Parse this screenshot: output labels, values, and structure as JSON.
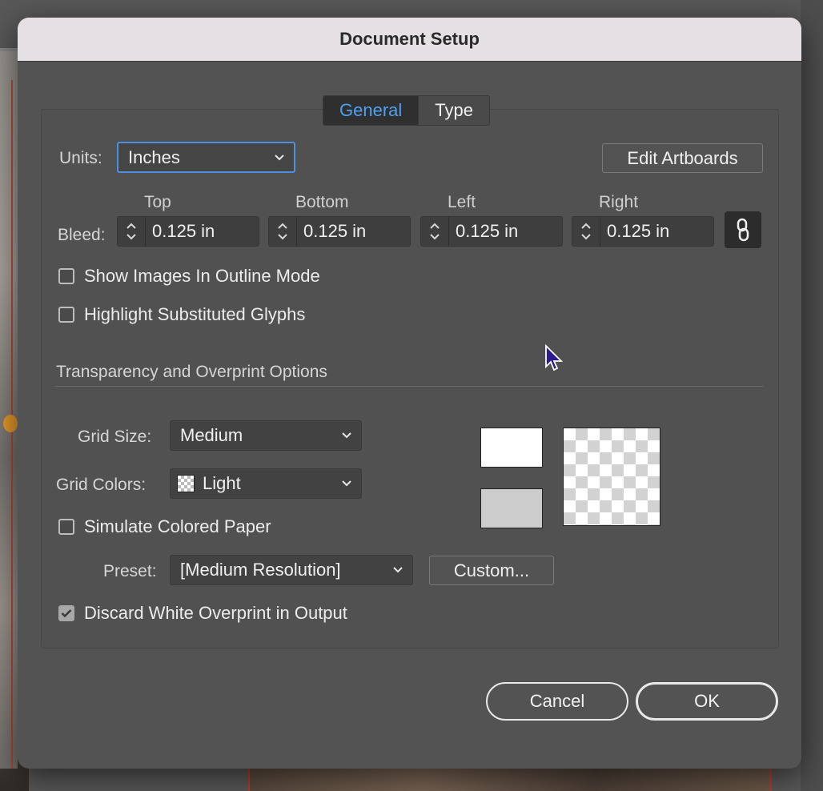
{
  "dialog": {
    "title": "Document Setup"
  },
  "tabs": [
    {
      "label": "General",
      "active": true
    },
    {
      "label": "Type",
      "active": false
    }
  ],
  "units": {
    "label": "Units:",
    "value": "Inches"
  },
  "edit_artboards_label": "Edit Artboards",
  "bleed": {
    "label": "Bleed:",
    "fields": [
      {
        "heading": "Top",
        "value": "0.125 in"
      },
      {
        "heading": "Bottom",
        "value": "0.125 in"
      },
      {
        "heading": "Left",
        "value": "0.125 in"
      },
      {
        "heading": "Right",
        "value": "0.125 in"
      }
    ],
    "link_icon": "chain-link-icon"
  },
  "options": {
    "show_images_outline": {
      "label": "Show Images In Outline Mode",
      "checked": false
    },
    "highlight_glyphs": {
      "label": "Highlight Substituted Glyphs",
      "checked": false
    }
  },
  "transparency": {
    "section_title": "Transparency and Overprint Options",
    "grid_size": {
      "label": "Grid Size:",
      "value": "Medium"
    },
    "grid_colors": {
      "label": "Grid Colors:",
      "value": "Light"
    },
    "simulate_paper": {
      "label": "Simulate Colored Paper",
      "checked": false
    },
    "preset": {
      "label": "Preset:",
      "value": "[Medium Resolution]"
    },
    "custom_label": "Custom...",
    "discard_white": {
      "label": "Discard White Overprint in Output",
      "checked": true
    },
    "swatch_colors": {
      "top": "#ffffff",
      "bottom": "#cccccc"
    }
  },
  "footer": {
    "cancel_label": "Cancel",
    "ok_label": "OK"
  },
  "colors": {
    "accent": "#4ea0f0",
    "dialog_bg": "#535353",
    "titlebar_bg": "#e4e0e4"
  }
}
